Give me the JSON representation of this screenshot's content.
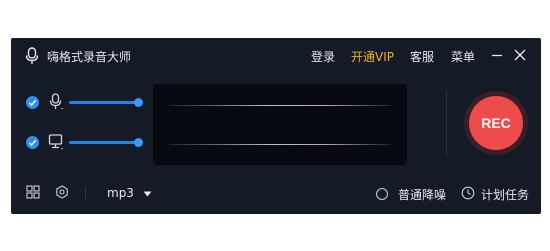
{
  "app": {
    "title": "嗨格式录音大师",
    "menu": [
      "登录",
      "开通VIP",
      "客服",
      "菜单"
    ]
  },
  "sources": [
    {
      "name": "microphone",
      "checked": true,
      "level": 0.92
    },
    {
      "name": "system-audio",
      "checked": true,
      "level": 0.92
    }
  ],
  "record_button": "REC",
  "bottom": {
    "format": "mp3",
    "noise_reduction": "普通降噪",
    "schedule": "计划任务"
  },
  "colors": {
    "background": "#141a26",
    "accent": "#1f86ee",
    "vip": "#f2b21c",
    "record": "#ee4c4c"
  }
}
